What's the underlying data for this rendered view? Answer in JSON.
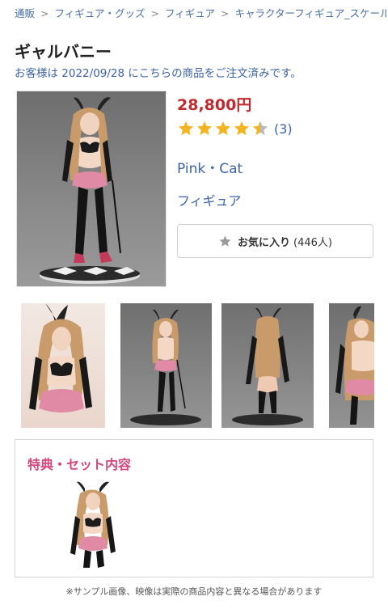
{
  "breadcrumb": {
    "items": [
      "通販",
      "フィギュア・グッズ",
      "フィギュア",
      "キャラクターフィギュア_スケール"
    ],
    "separator": ">"
  },
  "product": {
    "title": "ギャルバニー",
    "order_note": "お客様は 2022/09/28 にこちらの商品をご注文済みです。",
    "price": "28,800円",
    "rating": 4.5,
    "review_count": "(3)",
    "variant": "Pink・Cat",
    "category": "フィギュア"
  },
  "favorite": {
    "label": "お気に入り",
    "count": "(446人)",
    "icon": "star-icon"
  },
  "bonus": {
    "heading": "特典・セット内容"
  },
  "disclaimer": "※サンプル画像、映像は実際の商品内容と異なる場合があります",
  "colors": {
    "price": "#c0292d",
    "link": "#3d64a8",
    "star": "#f3b421",
    "bonus_heading": "#d6457b"
  }
}
